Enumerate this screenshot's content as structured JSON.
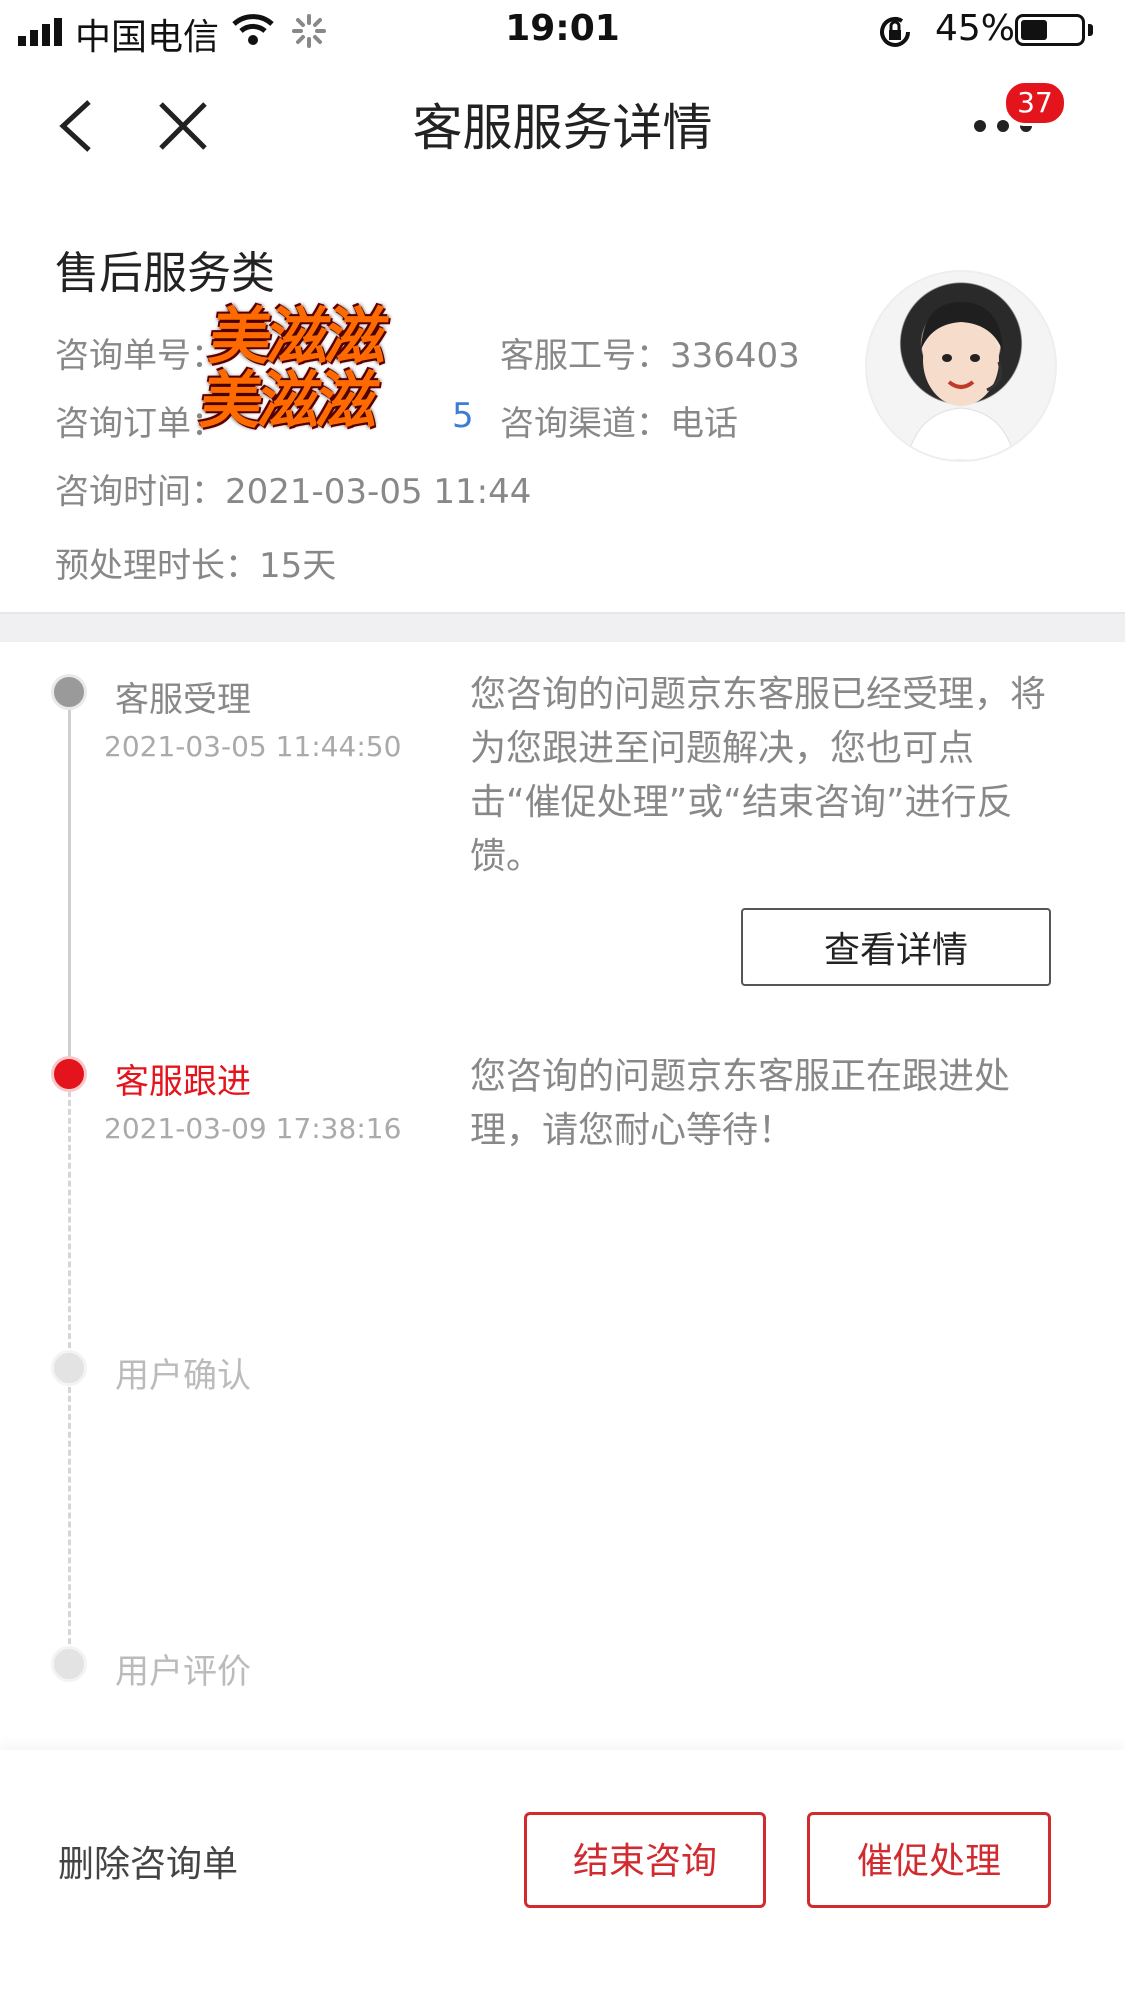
{
  "status_bar": {
    "carrier": "中国电信",
    "time": "19:01",
    "battery_percent": "45%",
    "battery_level": 0.45
  },
  "nav": {
    "title": "客服服务详情",
    "badge_count": "37"
  },
  "header": {
    "category": "售后服务类",
    "inquiry_no_label": "咨询单号：",
    "inquiry_order_label": "咨询订单：",
    "inquiry_order_partial": "5",
    "agent_id_label": "客服工号：",
    "agent_id": "336403",
    "channel_label": "咨询渠道：",
    "channel": "电话",
    "time_label": "咨询时间：",
    "time": "2021-03-05 11:44",
    "duration_label": "预处理时长：",
    "duration": "15天",
    "watermark_line1": "美滋滋",
    "watermark_line2": "美滋滋"
  },
  "timeline": {
    "steps": [
      {
        "label": "客服受理",
        "time": "2021-03-05 11:44:50",
        "desc": "您咨询的问题京东客服已经受理，将为您跟进至问题解决，您也可点击“催促处理”或“结束咨询”进行反馈。",
        "button": "查看详情",
        "color": "#888888"
      },
      {
        "label": "客服跟进",
        "time": "2021-03-09 17:38:16",
        "desc": "您咨询的问题京东客服正在跟进处理，请您耐心等待！",
        "color": "#e4141c"
      },
      {
        "label": "用户确认",
        "color": "#bbbbbb"
      },
      {
        "label": "用户评价",
        "color": "#bbbbbb"
      }
    ]
  },
  "footer": {
    "delete_label": "删除咨询单",
    "end_label": "结束咨询",
    "urge_label": "催促处理"
  },
  "colors": {
    "accent_red": "#e4141c",
    "button_red": "#d22b2f",
    "link_blue": "#3a7fd5"
  }
}
